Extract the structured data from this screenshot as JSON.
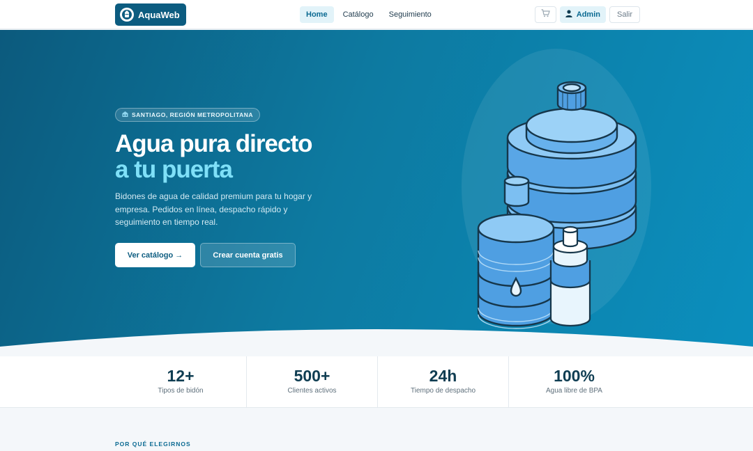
{
  "navbar": {
    "brand": "AquaWeb",
    "links": [
      {
        "label": "Home",
        "active": true
      },
      {
        "label": "Catálogo",
        "active": false
      },
      {
        "label": "Seguimiento",
        "active": false
      }
    ],
    "cart_icon": "cart-icon",
    "admin_label": "Admin",
    "admin_icon": "user-icon",
    "logout_label": "Salir"
  },
  "hero": {
    "badge": "SANTIAGO, REGIÓN METROPOLITANA",
    "badge_icon": "building-icon",
    "title_line1": "Agua pura directo",
    "title_line2": "a tu puerta",
    "description": "Bidones de agua de calidad premium para tu hogar y empresa. Pedidos en línea, despacho rápido y seguimiento en tiempo real.",
    "primary_cta": "Ver catálogo →",
    "secondary_cta": "Crear cuenta gratis"
  },
  "stats": [
    {
      "value": "12+",
      "label": "Tipos de bidón"
    },
    {
      "value": "500+",
      "label": "Clientes activos"
    },
    {
      "value": "24h",
      "label": "Tiempo de despacho"
    },
    {
      "value": "100%",
      "label": "Agua libre de BPA"
    }
  ],
  "section": {
    "eyebrow": "POR QUÉ ELEGIRNOS"
  },
  "colors": {
    "brand": "#0c5c80",
    "accent": "#7fe0f8",
    "hero_start": "#0c5a7d",
    "hero_end": "#0b8fbe"
  }
}
